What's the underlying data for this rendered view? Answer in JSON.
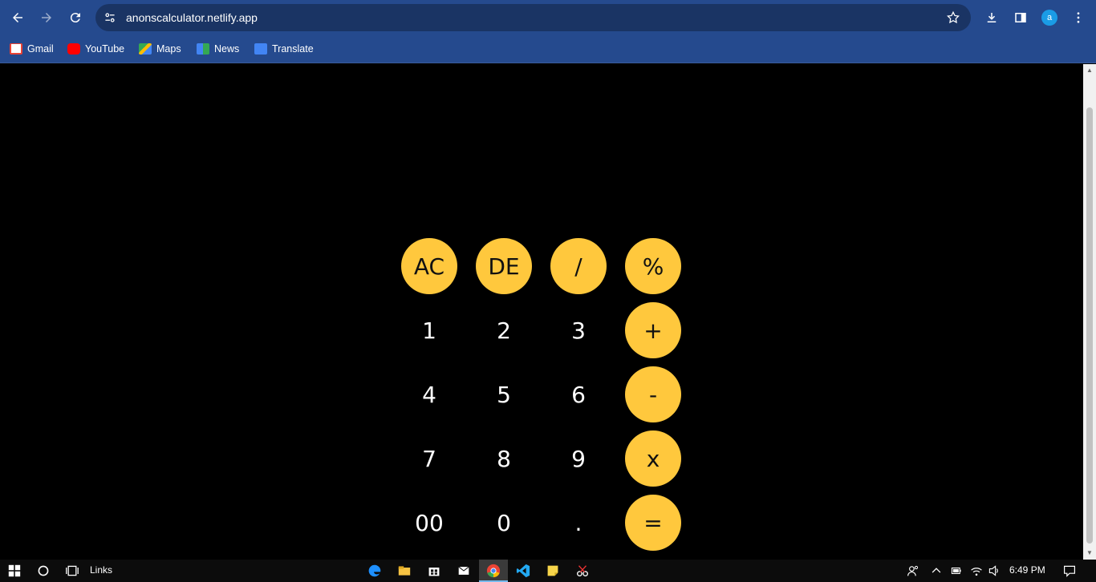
{
  "browser": {
    "url": "anonscalculator.netlify.app",
    "profile_initial": "a",
    "bookmarks": [
      {
        "label": "Gmail",
        "color": "#ea4335"
      },
      {
        "label": "YouTube",
        "color": "#ff0000"
      },
      {
        "label": "Maps",
        "color": "#34a853"
      },
      {
        "label": "News",
        "color": "#4285f4"
      },
      {
        "label": "Translate",
        "color": "#4285f4"
      }
    ]
  },
  "calculator": {
    "accent": "#ffc83d",
    "keys": [
      {
        "label": "AC",
        "kind": "op"
      },
      {
        "label": "DE",
        "kind": "op"
      },
      {
        "label": "/",
        "kind": "op"
      },
      {
        "label": "%",
        "kind": "op"
      },
      {
        "label": "1",
        "kind": "num"
      },
      {
        "label": "2",
        "kind": "num"
      },
      {
        "label": "3",
        "kind": "num"
      },
      {
        "label": "+",
        "kind": "op"
      },
      {
        "label": "4",
        "kind": "num"
      },
      {
        "label": "5",
        "kind": "num"
      },
      {
        "label": "6",
        "kind": "num"
      },
      {
        "label": "-",
        "kind": "op"
      },
      {
        "label": "7",
        "kind": "num"
      },
      {
        "label": "8",
        "kind": "num"
      },
      {
        "label": "9",
        "kind": "num"
      },
      {
        "label": "x",
        "kind": "op"
      },
      {
        "label": "00",
        "kind": "num"
      },
      {
        "label": "0",
        "kind": "num"
      },
      {
        "label": ".",
        "kind": "num"
      },
      {
        "label": "=",
        "kind": "op"
      }
    ]
  },
  "taskbar": {
    "links_label": "Links",
    "time": "6:49 PM"
  }
}
